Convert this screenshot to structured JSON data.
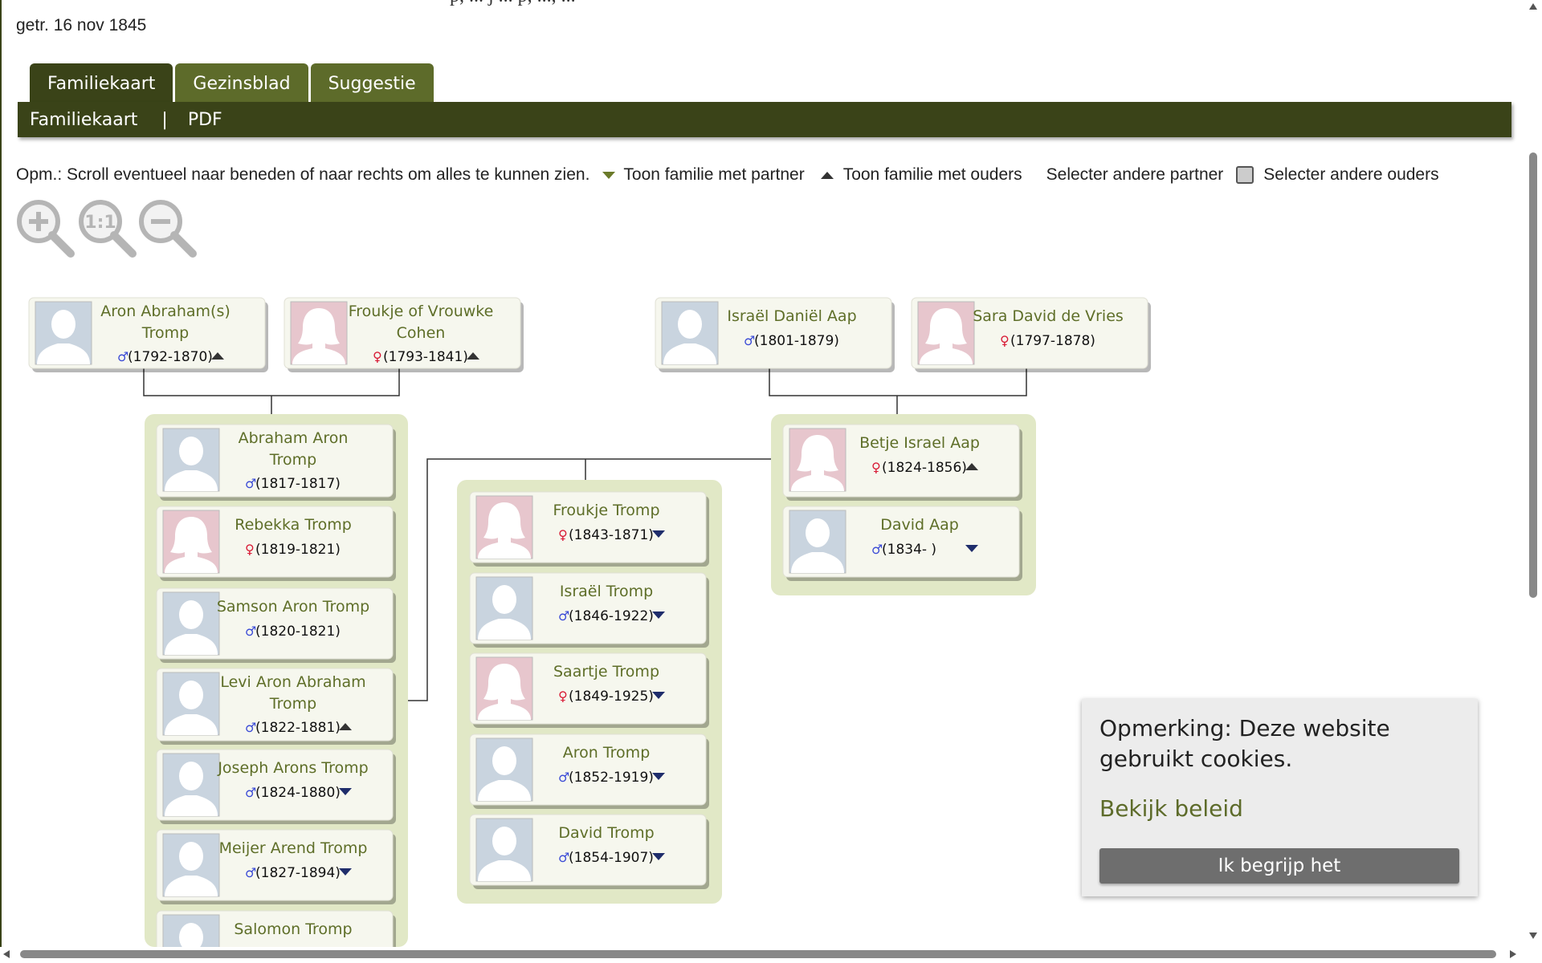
{
  "page": {
    "clipped_title": "p, ... j ... p, ..., ...",
    "marriage": "getr. 16 nov 1845"
  },
  "tabs": [
    {
      "label": "Familiekaart",
      "active": true
    },
    {
      "label": "Gezinsblad",
      "active": false
    },
    {
      "label": "Suggestie",
      "active": false
    }
  ],
  "subnav": {
    "item1": "Familiekaart",
    "separator": "|",
    "item2": "PDF"
  },
  "note": {
    "text": "Opm.: Scroll eventueel naar beneden of naar rechts om alles te kunnen zien.",
    "show_partner": "Toon familie met partner",
    "show_parents": "Toon familie met ouders",
    "select_partner": "Selecter andere partner",
    "select_parents": "Selecter andere ouders"
  },
  "zoom": {
    "in": "zoom-in-icon",
    "reset_label": "1:1",
    "out": "zoom-out-icon"
  },
  "colors": {
    "dark_olive": "#3a4318",
    "olive": "#5d6b2a",
    "name_green": "#5e6e28",
    "card_bg": "#f6f7ee",
    "group_bg": "#e1e8c6",
    "male_avatar": "#c9d4df",
    "female_avatar": "#e7c6cd",
    "male_symbol": "#3b4bd6",
    "female_symbol": "#d81b35",
    "chevron": "#1f2d6b"
  },
  "symbols": {
    "male": "♂",
    "female": "♀"
  },
  "people": [
    {
      "name_l1": "Aron Abraham(s)",
      "name_l2": "Tromp",
      "years": "(1792-1870)",
      "gender": "m",
      "chev": "up"
    },
    {
      "name_l1": "Froukje of Vrouwke",
      "name_l2": "Cohen",
      "years": "(1793-1841)",
      "gender": "f",
      "chev": "up"
    },
    {
      "name_l1": "Israël Daniël Aap",
      "name_l2": "",
      "years": "(1801-1879)",
      "gender": "m",
      "chev": ""
    },
    {
      "name_l1": "Sara David de Vries",
      "name_l2": "",
      "years": "(1797-1878)",
      "gender": "f",
      "chev": ""
    },
    {
      "name_l1": "Abraham Aron",
      "name_l2": "Tromp",
      "years": "(1817-1817)",
      "gender": "m",
      "chev": ""
    },
    {
      "name_l1": "Rebekka Tromp",
      "name_l2": "",
      "years": "(1819-1821)",
      "gender": "f",
      "chev": ""
    },
    {
      "name_l1": "Samson Aron Tromp",
      "name_l2": "",
      "years": "(1820-1821)",
      "gender": "m",
      "chev": ""
    },
    {
      "name_l1": "Levi Aron Abraham",
      "name_l2": "Tromp",
      "years": "(1822-1881)",
      "gender": "m",
      "chev": "up"
    },
    {
      "name_l1": "Joseph Arons Tromp",
      "name_l2": "",
      "years": "(1824-1880)",
      "gender": "m",
      "chev": "down"
    },
    {
      "name_l1": "Meijer Arend Tromp",
      "name_l2": "",
      "years": "(1827-1894)",
      "gender": "m",
      "chev": "down"
    },
    {
      "name_l1": "Salomon Tromp",
      "name_l2": "",
      "years": "",
      "gender": "m",
      "chev": ""
    },
    {
      "name_l1": "Froukje Tromp",
      "name_l2": "",
      "years": "(1843-1871)",
      "gender": "f",
      "chev": "down"
    },
    {
      "name_l1": "Israël Tromp",
      "name_l2": "",
      "years": "(1846-1922)",
      "gender": "m",
      "chev": "down"
    },
    {
      "name_l1": "Saartje Tromp",
      "name_l2": "",
      "years": "(1849-1925)",
      "gender": "f",
      "chev": "down"
    },
    {
      "name_l1": "Aron Tromp",
      "name_l2": "",
      "years": "(1852-1919)",
      "gender": "m",
      "chev": "down"
    },
    {
      "name_l1": "David Tromp",
      "name_l2": "",
      "years": "(1854-1907)",
      "gender": "m",
      "chev": "down"
    },
    {
      "name_l1": "Betje Israel Aap",
      "name_l2": "",
      "years": "(1824-1856)",
      "gender": "f",
      "chev": "up"
    },
    {
      "name_l1": "David Aap",
      "name_l2": "",
      "years": "(1834- )",
      "gender": "m",
      "chev": "down"
    }
  ],
  "cookie": {
    "message": "Opmerking: Deze website gebruikt cookies.",
    "policy_link": "Bekijk beleid",
    "accept_button": "Ik begrijp het"
  }
}
